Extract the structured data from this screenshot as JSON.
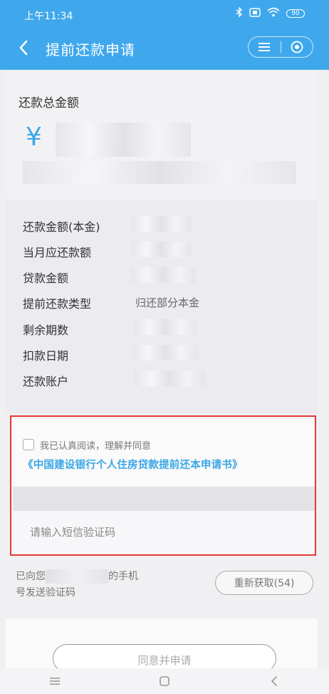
{
  "status_bar": {
    "time": "上午11:34",
    "battery": "90"
  },
  "header": {
    "title": "提前还款申请"
  },
  "amount_section": {
    "label": "还款总金额",
    "currency": "¥"
  },
  "details": [
    {
      "label": "还款金额(本金)",
      "value": ""
    },
    {
      "label": "当月应还款额",
      "value": ""
    },
    {
      "label": "贷款金额",
      "value": ""
    },
    {
      "label": "提前还款类型",
      "value": "归还部分本金"
    },
    {
      "label": "剩余期数",
      "value": ""
    },
    {
      "label": "扣款日期",
      "value": ""
    },
    {
      "label": "还款账户",
      "value": ""
    }
  ],
  "agreement": {
    "checkbox_text": "我已认真阅读，理解并同意",
    "link_text": "《中国建设银行个人住房贷款提前还本申请书》"
  },
  "sms": {
    "input_placeholder": "请输入短信验证码",
    "text_before": "已向您",
    "text_after": "的手机",
    "text_line2": "号发送验证码",
    "resend_label": "重新获取(54)"
  },
  "submit": {
    "label": "同意并申请"
  }
}
